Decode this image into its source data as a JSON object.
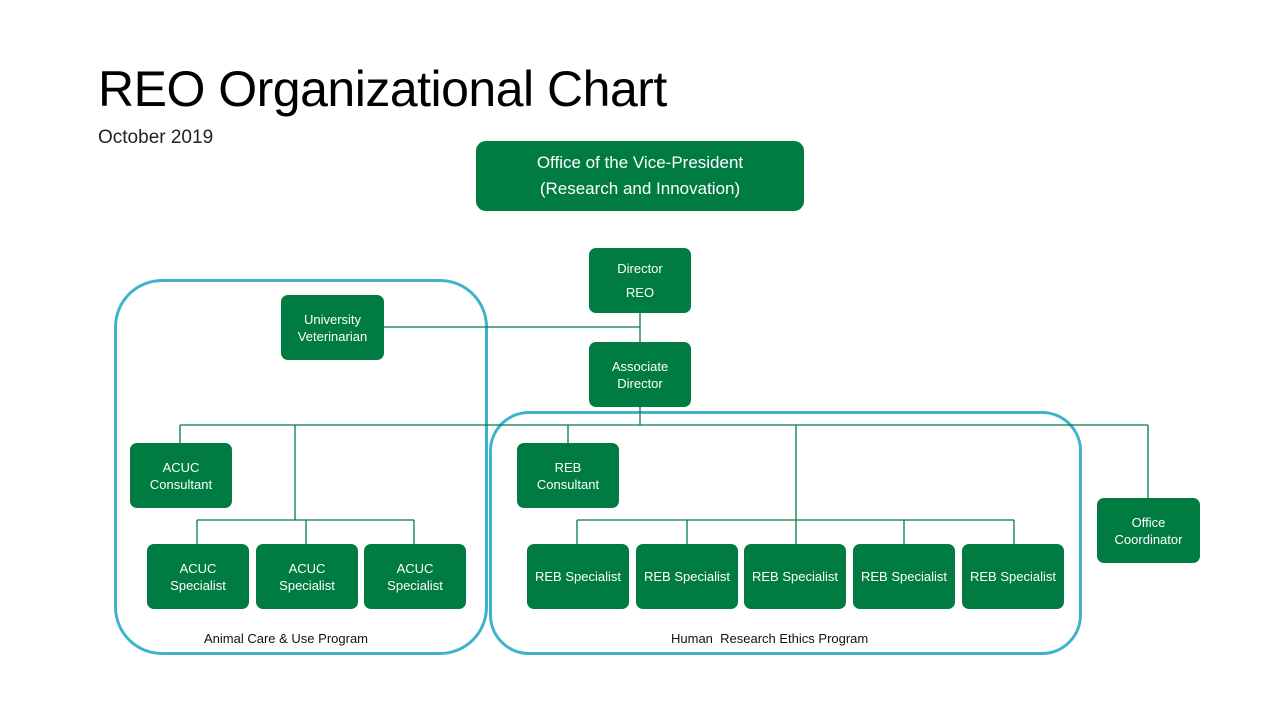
{
  "header": {
    "title": "REO Organizational Chart",
    "subtitle": "October 2019"
  },
  "colors": {
    "node_fill": "#007c42",
    "node_text": "#ffffff",
    "group_border": "#3fb3cd",
    "connector": "#007c42"
  },
  "nodes": {
    "vp_office": "Office of the Vice-President\n(Research  and Innovation)",
    "director": "Director\nREO",
    "associate_director": "Associate\nDirector",
    "university_veterinarian": "University\nVeterinarian",
    "acuc_consultant": "ACUC\nConsultant",
    "acuc_specialists": [
      "ACUC\nSpecialist",
      "ACUC\nSpecialist",
      "ACUC\nSpecialist"
    ],
    "reb_consultant": "REB\nConsultant",
    "reb_specialists": [
      "REB Specialist",
      "REB Specialist",
      "REB Specialist",
      "REB Specialist",
      "REB Specialist"
    ],
    "office_coordinator": "Office\nCoordinator"
  },
  "groups": {
    "animal_care": "Animal Care & Use Program",
    "human_research": "Human  Research Ethics Program"
  }
}
